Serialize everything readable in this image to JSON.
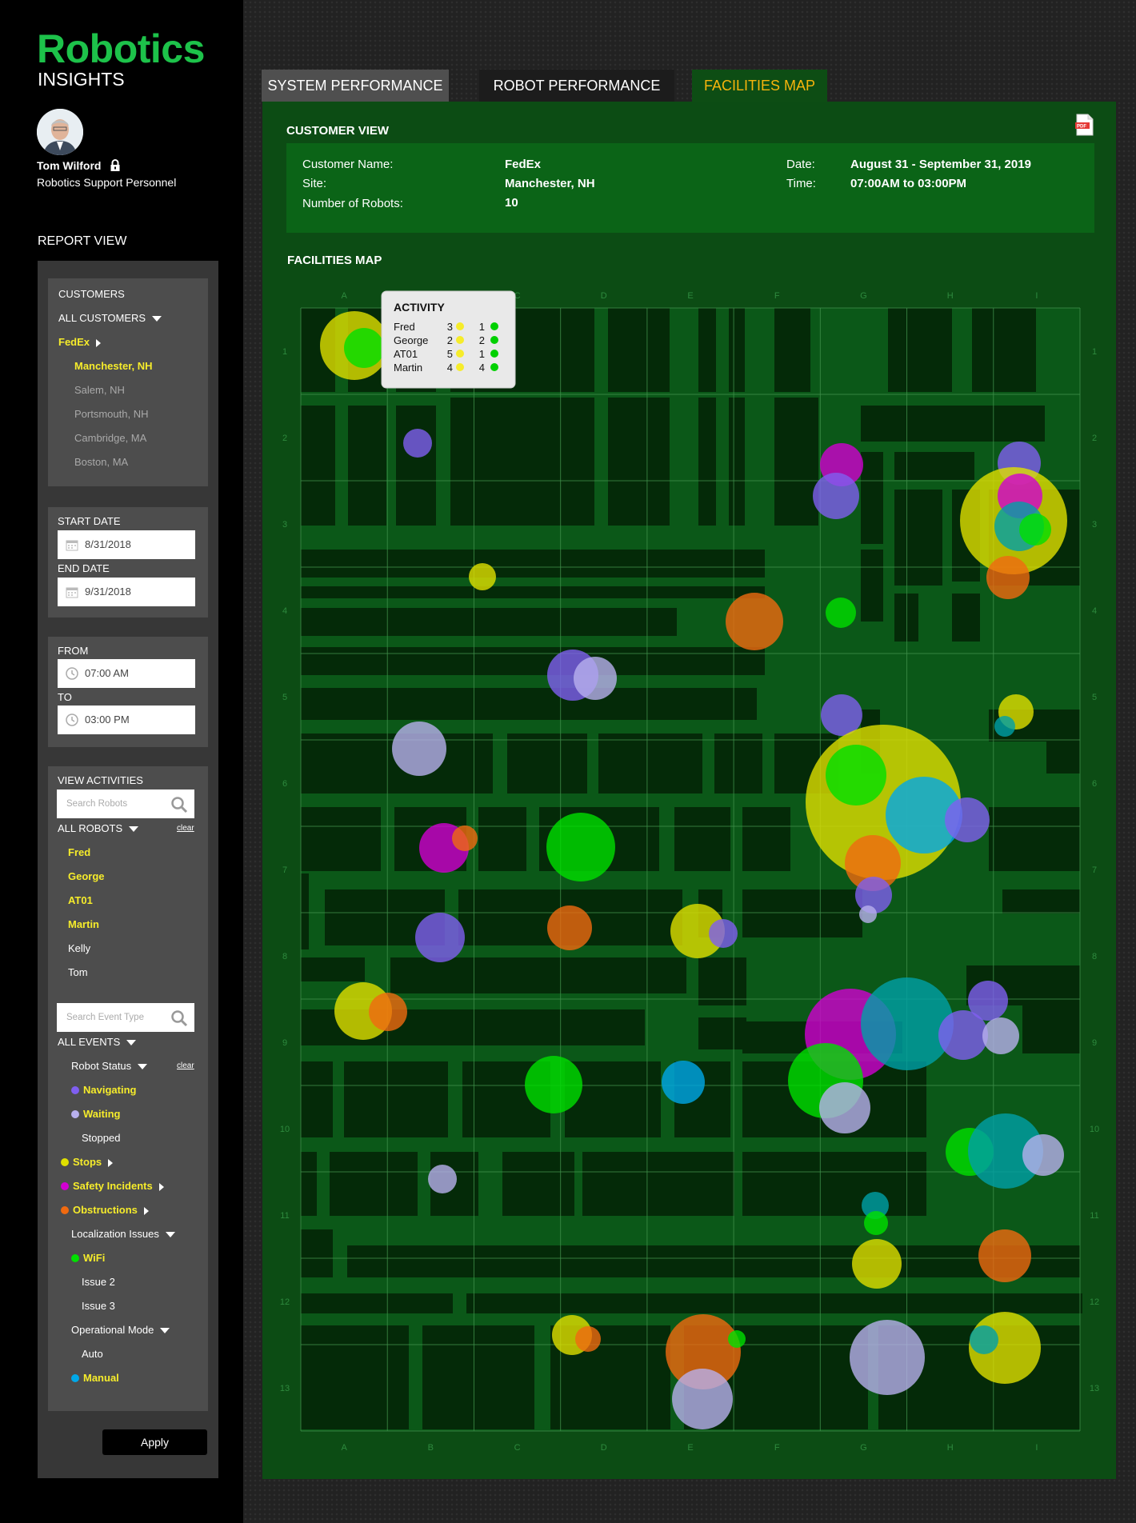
{
  "brand": {
    "title": "Robotics",
    "subtitle": "INSIGHTS"
  },
  "user": {
    "name": "Tom Wilford",
    "role": "Robotics Support Personnel"
  },
  "sidebar": {
    "report_view": "REPORT VIEW",
    "customers": {
      "heading": "CUSTOMERS",
      "all": "ALL CUSTOMERS",
      "selected": "FedEx",
      "sites": [
        {
          "label": "Manchester, NH",
          "active": true
        },
        {
          "label": "Salem, NH",
          "active": false
        },
        {
          "label": "Portsmouth, NH",
          "active": false
        },
        {
          "label": "Cambridge, MA",
          "active": false
        },
        {
          "label": "Boston, MA",
          "active": false
        }
      ]
    },
    "dates": {
      "start_label": "START DATE",
      "start_value": "8/31/2018",
      "end_label": "END DATE",
      "end_value": "9/31/2018"
    },
    "times": {
      "from_label": "FROM",
      "from_value": "07:00 AM",
      "to_label": "TO",
      "to_value": "03:00 PM"
    },
    "activities": {
      "heading": "VIEW ACTIVITIES",
      "search_robots_placeholder": "Search Robots",
      "all_robots": "ALL ROBOTS",
      "clear": "clear",
      "robots": [
        {
          "label": "Fred",
          "active": true
        },
        {
          "label": "George",
          "active": true
        },
        {
          "label": "AT01",
          "active": true
        },
        {
          "label": "Martin",
          "active": true
        },
        {
          "label": "Kelly",
          "active": false
        },
        {
          "label": "Tom",
          "active": false
        }
      ],
      "search_events_placeholder": "Search Event Type",
      "all_events": "ALL EVENTS",
      "robot_status": "Robot Status",
      "status_clear": "clear",
      "navigating": "Navigating",
      "waiting": "Waiting",
      "stopped": "Stopped",
      "stops": "Stops",
      "safety": "Safety Incidents",
      "obstructions": "Obstructions",
      "localization": "Localization Issues",
      "wifi": "WiFi",
      "issue2": "Issue 2",
      "issue3": "Issue 3",
      "op_mode": "Operational Mode",
      "auto": "Auto",
      "manual": "Manual"
    },
    "apply": "Apply"
  },
  "tabs": [
    "SYSTEM PERFORMANCE",
    "ROBOT PERFORMANCE",
    "FACILITIES MAP"
  ],
  "active_tab": "FACILITIES MAP",
  "customer_view": {
    "title": "CUSTOMER VIEW",
    "name_label": "Customer Name:",
    "name_value": "FedEx",
    "site_label": "Site:",
    "site_value": "Manchester, NH",
    "robots_label": "Number of Robots:",
    "robots_value": "10",
    "date_label": "Date:",
    "date_value": "August 31 - September 31, 2019",
    "time_label": "Time:",
    "time_value": "07:00AM to 03:00PM"
  },
  "facilities_map": {
    "title": "FACILITIES MAP",
    "columns": [
      "A",
      "B",
      "C",
      "D",
      "E",
      "F",
      "G",
      "H",
      "I"
    ],
    "rows": [
      "1",
      "2",
      "3",
      "4",
      "5",
      "6",
      "7",
      "8",
      "9",
      "10",
      "11",
      "12",
      "13"
    ],
    "activity_popup": {
      "title": "ACTIVITY",
      "rows": [
        {
          "name": "Fred",
          "yellow": 3,
          "green": 1
        },
        {
          "name": "George",
          "yellow": 2,
          "green": 2
        },
        {
          "name": "AT01",
          "yellow": 5,
          "green": 1
        },
        {
          "name": "Martin",
          "yellow": 4,
          "green": 4
        }
      ]
    }
  },
  "colors": {
    "brand_green": "#1dc24a",
    "highlight_yellow": "#f6ec2b",
    "navigating": "#7f5ff0",
    "waiting": "#b8b0ee",
    "stops": "#e0e000",
    "safety": "#d100d1",
    "obstructions": "#f06a10",
    "wifi": "#00e000",
    "manual": "#00a8e8",
    "teal": "#00a0a8"
  }
}
